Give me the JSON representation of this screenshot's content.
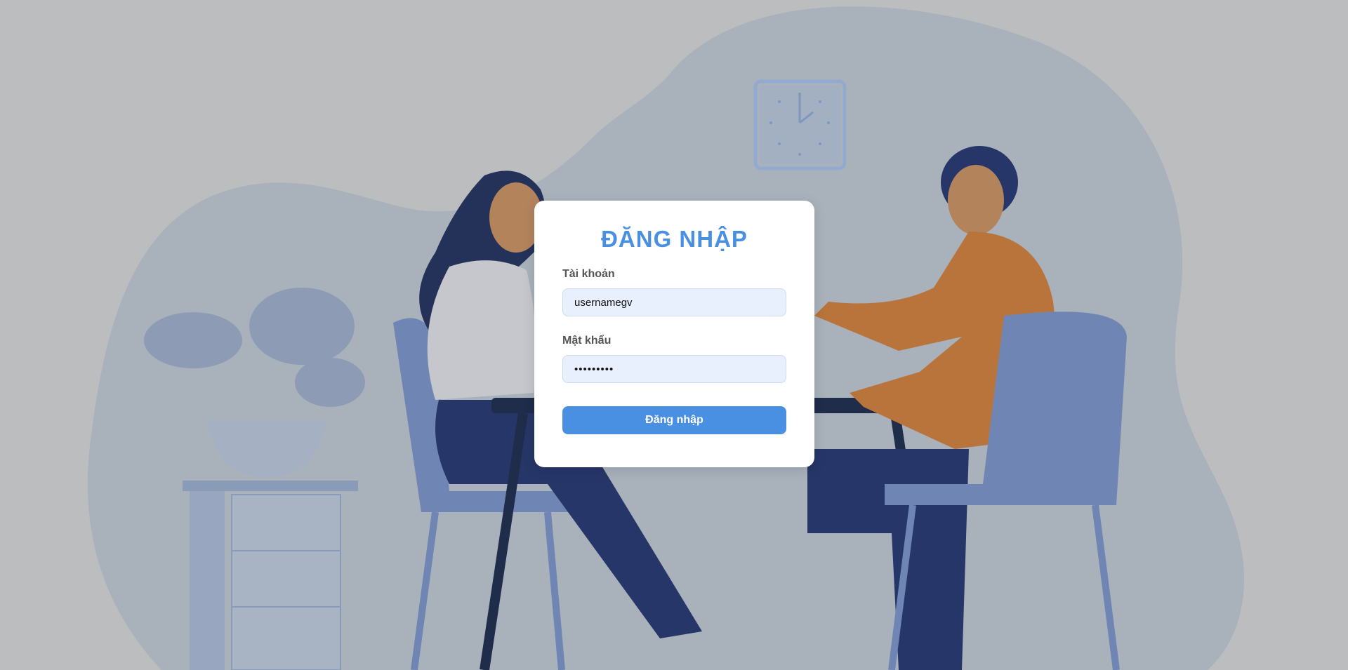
{
  "login": {
    "title": "ĐĂNG NHẬP",
    "username_label": "Tài khoản",
    "username_value": "usernamegv",
    "password_label": "Mật khẩu",
    "password_value": "•••••••••",
    "submit_label": "Đăng nhập"
  },
  "colors": {
    "accent": "#4a90e2",
    "page_background": "#bcbdbf",
    "input_background": "#e8f0fe"
  },
  "icons": [
    "wall-clock-illustration",
    "plant-illustration",
    "people-meeting-illustration"
  ]
}
